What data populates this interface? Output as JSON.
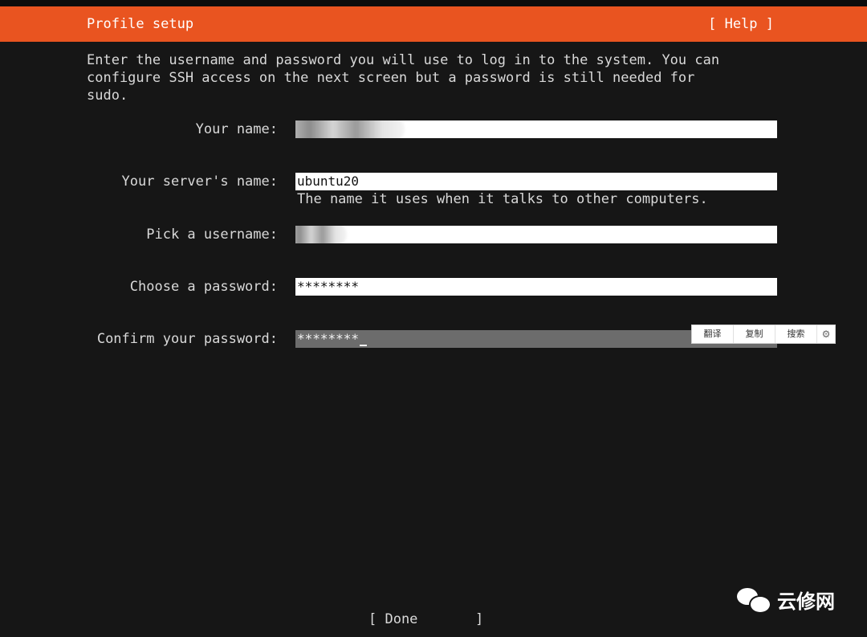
{
  "header": {
    "title": "Profile setup",
    "help": "[ Help ]"
  },
  "intro": "Enter the username and password you will use to log in to the system. You can\nconfigure SSH access on the next screen but a password is still needed for\nsudo.",
  "form": {
    "name_label": "Your name:",
    "name_value": "",
    "server_label": "Your server's name:",
    "server_value": "ubuntu20",
    "server_hint": "The name it uses when it talks to other computers.",
    "username_label": "Pick a username:",
    "username_value": "",
    "password_label": "Choose a password:",
    "password_value": "********",
    "confirm_label": "Confirm your password:",
    "confirm_value": "********"
  },
  "popup": {
    "translate": "翻译",
    "copy": "复制",
    "search": "搜索",
    "settings_icon": "gear-icon"
  },
  "done_button": "[ Done       ]",
  "watermark": {
    "text": "云修网",
    "icon": "wechat-icon"
  },
  "colors": {
    "header": "#e95420",
    "background": "#161616",
    "active_field": "#6c6c6c"
  }
}
